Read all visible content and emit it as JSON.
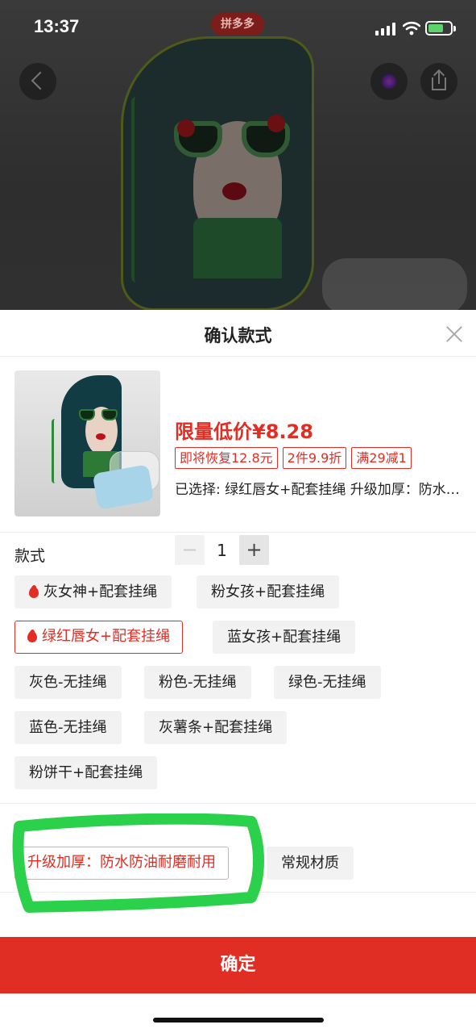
{
  "status_bar": {
    "time": "13:37",
    "center_badge": "拼多多"
  },
  "top_buttons": {
    "back": "chevron-left-icon",
    "favorite": "favorite-icon",
    "share": "share-icon"
  },
  "sheet": {
    "title": "确认款式",
    "product": {
      "price_text": "限量低价¥8.28",
      "tags": [
        "即将恢复12.8元",
        "2件9.9折",
        "满29减1"
      ],
      "selected_text": "已选择: 绿红唇女+配套挂绳 升级加厚：防水防油耐磨耐用",
      "quantity": "1",
      "minus_label": "−",
      "plus_label": "+"
    },
    "style_section": {
      "label": "款式",
      "options": [
        {
          "label": "灰女神+配套挂绳",
          "hot": true,
          "selected": false
        },
        {
          "label": "粉女孩+配套挂绳",
          "hot": false,
          "selected": false
        },
        {
          "label": "绿红唇女+配套挂绳",
          "hot": true,
          "selected": true
        },
        {
          "label": "蓝女孩+配套挂绳",
          "hot": false,
          "selected": false
        },
        {
          "label": "灰色-无挂绳",
          "hot": false,
          "selected": false
        },
        {
          "label": "粉色-无挂绳",
          "hot": false,
          "selected": false
        },
        {
          "label": "绿色-无挂绳",
          "hot": false,
          "selected": false
        },
        {
          "label": "蓝色-无挂绳",
          "hot": false,
          "selected": false
        },
        {
          "label": "灰薯条+配套挂绳",
          "hot": false,
          "selected": false
        },
        {
          "label": "粉饼干+配套挂绳",
          "hot": false,
          "selected": false
        }
      ]
    },
    "material_section": {
      "label": "",
      "options": [
        {
          "label": "升级加厚：防水防油耐磨耐用",
          "selected": true
        },
        {
          "label": "常规材质",
          "selected": false
        }
      ]
    },
    "confirm_label": "确定"
  },
  "colors": {
    "accent": "#e02e24",
    "option_bg": "#f2f2f2",
    "highlight_stroke": "#2bd14a"
  }
}
